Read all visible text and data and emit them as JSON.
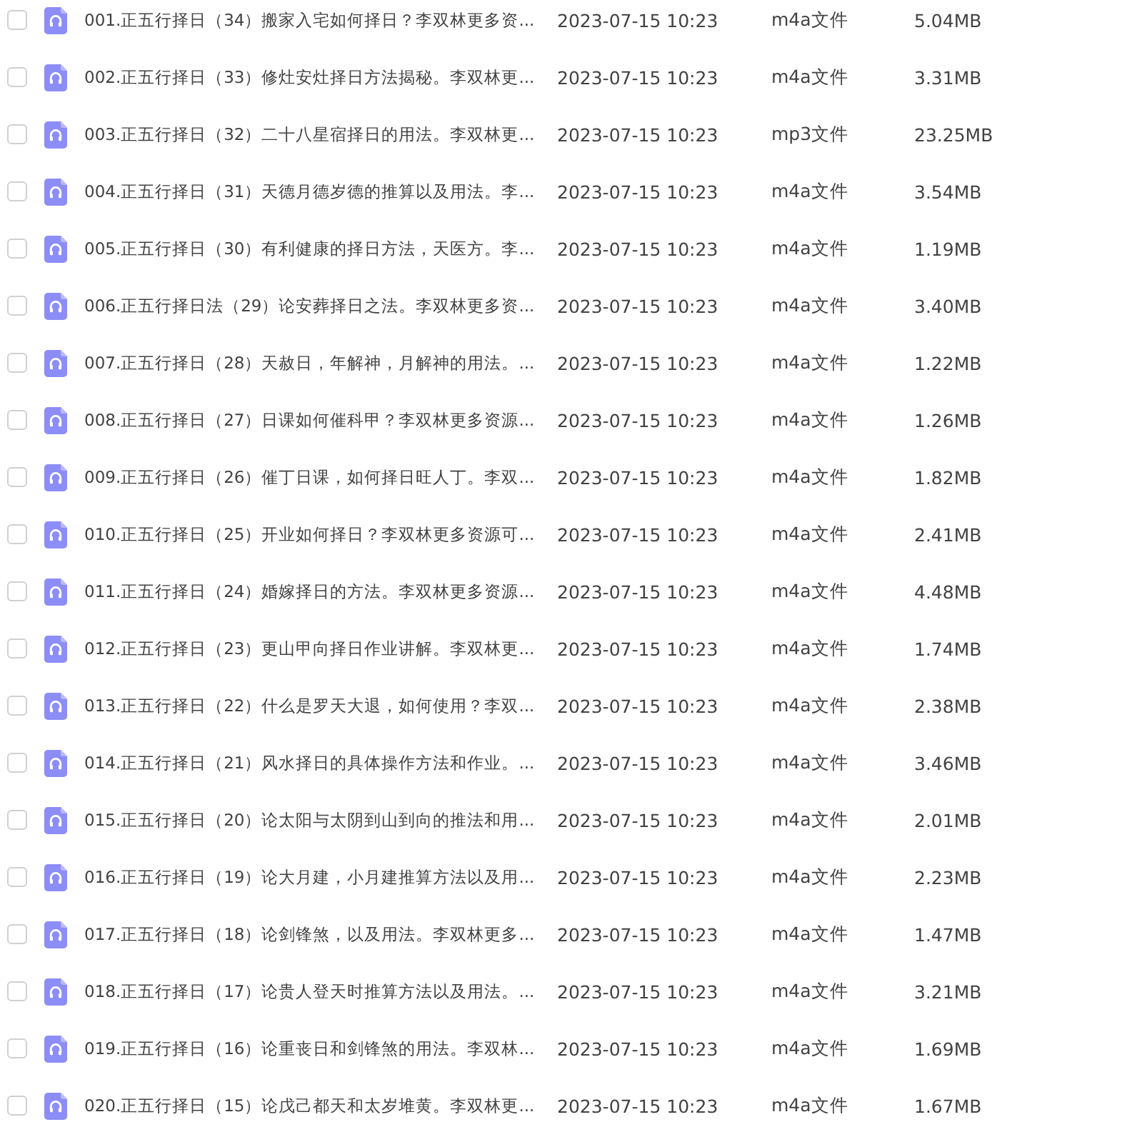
{
  "files": [
    {
      "name": "001.正五行择日（34）搬家入宅如何择日？李双林更多资...",
      "modified": "2023-07-15 10:23",
      "type": "m4a文件",
      "size": "5.04MB",
      "checked": false
    },
    {
      "name": "002.正五行择日（33）修灶安灶择日方法揭秘。李双林更...",
      "modified": "2023-07-15 10:23",
      "type": "m4a文件",
      "size": "3.31MB",
      "checked": false
    },
    {
      "name": "003.正五行择日（32）二十八星宿择日的用法。李双林更...",
      "modified": "2023-07-15 10:23",
      "type": "mp3文件",
      "size": "23.25MB",
      "checked": false
    },
    {
      "name": "004.正五行择日（31）天德月德岁德的推算以及用法。李...",
      "modified": "2023-07-15 10:23",
      "type": "m4a文件",
      "size": "3.54MB",
      "checked": false
    },
    {
      "name": "005.正五行择日（30）有利健康的择日方法，天医方。李...",
      "modified": "2023-07-15 10:23",
      "type": "m4a文件",
      "size": "1.19MB",
      "checked": false
    },
    {
      "name": "006.正五行择日法（29）论安葬择日之法。李双林更多资...",
      "modified": "2023-07-15 10:23",
      "type": "m4a文件",
      "size": "3.40MB",
      "checked": false
    },
    {
      "name": "007.正五行择日（28）天赦日，年解神，月解神的用法。...",
      "modified": "2023-07-15 10:23",
      "type": "m4a文件",
      "size": "1.22MB",
      "checked": false
    },
    {
      "name": "008.正五行择日（27）日课如何催科甲？李双林更多资源...",
      "modified": "2023-07-15 10:23",
      "type": "m4a文件",
      "size": "1.26MB",
      "checked": false
    },
    {
      "name": "009.正五行择日（26）催丁日课，如何择日旺人丁。李双...",
      "modified": "2023-07-15 10:23",
      "type": "m4a文件",
      "size": "1.82MB",
      "checked": false
    },
    {
      "name": "010.正五行择日（25）开业如何择日？李双林更多资源可...",
      "modified": "2023-07-15 10:23",
      "type": "m4a文件",
      "size": "2.41MB",
      "checked": false
    },
    {
      "name": "011.正五行择日（24）婚嫁择日的方法。李双林更多资源...",
      "modified": "2023-07-15 10:23",
      "type": "m4a文件",
      "size": "4.48MB",
      "checked": false
    },
    {
      "name": "012.正五行择日（23）更山甲向择日作业讲解。李双林更...",
      "modified": "2023-07-15 10:23",
      "type": "m4a文件",
      "size": "1.74MB",
      "checked": false
    },
    {
      "name": "013.正五行择日（22）什么是罗天大退，如何使用？李双...",
      "modified": "2023-07-15 10:23",
      "type": "m4a文件",
      "size": "2.38MB",
      "checked": false
    },
    {
      "name": "014.正五行择日（21）风水择日的具体操作方法和作业。...",
      "modified": "2023-07-15 10:23",
      "type": "m4a文件",
      "size": "3.46MB",
      "checked": false
    },
    {
      "name": "015.正五行择日（20）论太阳与太阴到山到向的推法和用...",
      "modified": "2023-07-15 10:23",
      "type": "m4a文件",
      "size": "2.01MB",
      "checked": false
    },
    {
      "name": "016.正五行择日（19）论大月建，小月建推算方法以及用...",
      "modified": "2023-07-15 10:23",
      "type": "m4a文件",
      "size": "2.23MB",
      "checked": false
    },
    {
      "name": "017.正五行择日（18）论剑锋煞，以及用法。李双林更多...",
      "modified": "2023-07-15 10:23",
      "type": "m4a文件",
      "size": "1.47MB",
      "checked": false
    },
    {
      "name": "018.正五行择日（17）论贵人登天时推算方法以及用法。...",
      "modified": "2023-07-15 10:23",
      "type": "m4a文件",
      "size": "3.21MB",
      "checked": false
    },
    {
      "name": "019.正五行择日（16）论重丧日和剑锋煞的用法。李双林...",
      "modified": "2023-07-15 10:23",
      "type": "m4a文件",
      "size": "1.69MB",
      "checked": false
    },
    {
      "name": "020.正五行择日（15）论戊己都天和太岁堆黄。李双林更...",
      "modified": "2023-07-15 10:23",
      "type": "m4a文件",
      "size": "1.67MB",
      "checked": false
    }
  ]
}
